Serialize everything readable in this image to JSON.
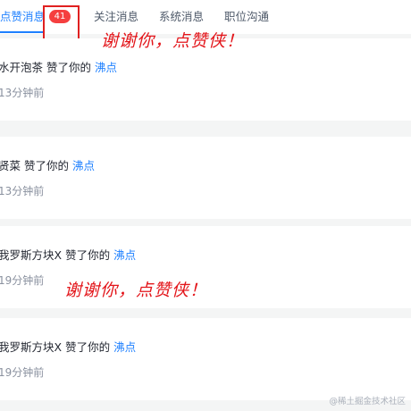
{
  "tabs": [
    {
      "label": "点赞消息",
      "active": true
    },
    {
      "label": "关注消息",
      "active": false
    },
    {
      "label": "系统消息",
      "active": false
    },
    {
      "label": "职位沟通",
      "active": false
    }
  ],
  "badge_count": "41",
  "notifications": [
    {
      "user": "水开泡茶",
      "action": "赞了你的",
      "target": "沸点",
      "time": "13分钟前"
    },
    {
      "user": "贤菜",
      "action": "赞了你的",
      "target": "沸点",
      "time": "13分钟前"
    },
    {
      "user": "我罗斯方块X",
      "action": "赞了你的",
      "target": "沸点",
      "time": "19分钟前"
    },
    {
      "user": "我罗斯方块X",
      "action": "赞了你的",
      "target": "沸点",
      "time": "19分钟前"
    }
  ],
  "annotations": [
    "谢谢你，点赞侠！",
    "谢谢你，点赞侠！"
  ],
  "watermark": "@稀土掘金技术社区",
  "colors": {
    "accent": "#1e80ff",
    "badge": "#f53f3f",
    "annotation": "#e3161b"
  }
}
